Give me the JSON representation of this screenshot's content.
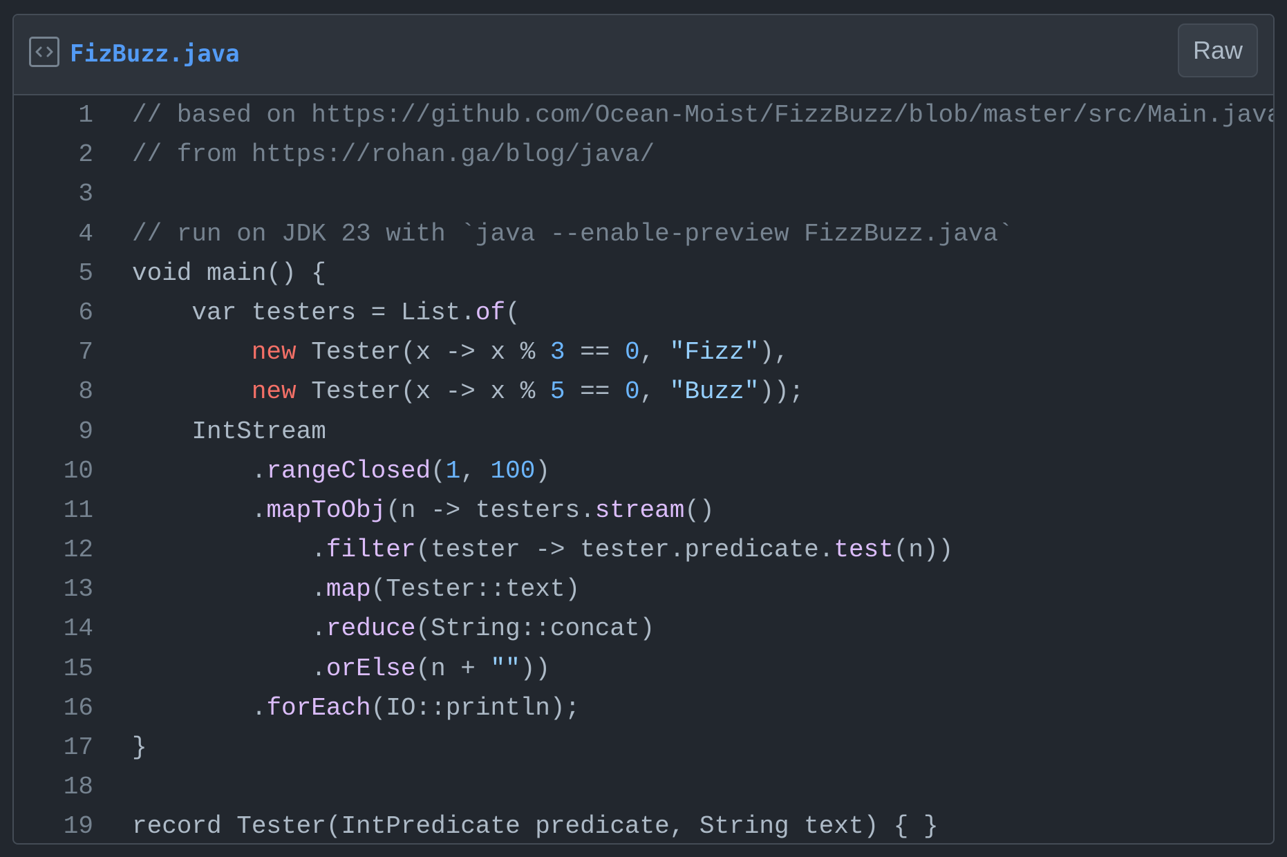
{
  "file": {
    "name": "FizBuzz.java",
    "icon": "code-file-icon",
    "raw_label": "Raw"
  },
  "colors": {
    "background": "#22272e",
    "header_background": "#2d333b",
    "border": "#444c56",
    "link": "#539bf5",
    "text": "#adbac7",
    "comment": "#768390",
    "keyword": "#f47067",
    "number": "#6cb6ff",
    "string": "#96d0ff",
    "function": "#dcbdfb"
  },
  "lines": [
    {
      "n": "1",
      "tokens": [
        {
          "t": "// based on https://github.com/Ocean-Moist/FizzBuzz/blob/master/src/Main.java",
          "c": "com"
        }
      ]
    },
    {
      "n": "2",
      "tokens": [
        {
          "t": "// from https://rohan.ga/blog/java/",
          "c": "com"
        }
      ]
    },
    {
      "n": "3",
      "tokens": []
    },
    {
      "n": "4",
      "tokens": [
        {
          "t": "// run on JDK 23 with `java --enable-preview FizzBuzz.java`",
          "c": "com"
        }
      ]
    },
    {
      "n": "5",
      "tokens": [
        {
          "t": "void main() {",
          "c": ""
        }
      ]
    },
    {
      "n": "6",
      "tokens": [
        {
          "t": "    var testers = List.",
          "c": ""
        },
        {
          "t": "of",
          "c": "fn"
        },
        {
          "t": "(",
          "c": ""
        }
      ]
    },
    {
      "n": "7",
      "tokens": [
        {
          "t": "        ",
          "c": ""
        },
        {
          "t": "new",
          "c": "kw"
        },
        {
          "t": " Tester(x -> x % ",
          "c": ""
        },
        {
          "t": "3",
          "c": "num"
        },
        {
          "t": " == ",
          "c": ""
        },
        {
          "t": "0",
          "c": "num"
        },
        {
          "t": ", ",
          "c": ""
        },
        {
          "t": "\"Fizz\"",
          "c": "str"
        },
        {
          "t": "),",
          "c": ""
        }
      ]
    },
    {
      "n": "8",
      "tokens": [
        {
          "t": "        ",
          "c": ""
        },
        {
          "t": "new",
          "c": "kw"
        },
        {
          "t": " Tester(x -> x % ",
          "c": ""
        },
        {
          "t": "5",
          "c": "num"
        },
        {
          "t": " == ",
          "c": ""
        },
        {
          "t": "0",
          "c": "num"
        },
        {
          "t": ", ",
          "c": ""
        },
        {
          "t": "\"Buzz\"",
          "c": "str"
        },
        {
          "t": "));",
          "c": ""
        }
      ]
    },
    {
      "n": "9",
      "tokens": [
        {
          "t": "    IntStream",
          "c": ""
        }
      ]
    },
    {
      "n": "10",
      "tokens": [
        {
          "t": "        .",
          "c": ""
        },
        {
          "t": "rangeClosed",
          "c": "fn"
        },
        {
          "t": "(",
          "c": ""
        },
        {
          "t": "1",
          "c": "num"
        },
        {
          "t": ", ",
          "c": ""
        },
        {
          "t": "100",
          "c": "num"
        },
        {
          "t": ")",
          "c": ""
        }
      ]
    },
    {
      "n": "11",
      "tokens": [
        {
          "t": "        .",
          "c": ""
        },
        {
          "t": "mapToObj",
          "c": "fn"
        },
        {
          "t": "(n -> testers.",
          "c": ""
        },
        {
          "t": "stream",
          "c": "fn"
        },
        {
          "t": "()",
          "c": ""
        }
      ]
    },
    {
      "n": "12",
      "tokens": [
        {
          "t": "            .",
          "c": ""
        },
        {
          "t": "filter",
          "c": "fn"
        },
        {
          "t": "(tester -> tester.predicate.",
          "c": ""
        },
        {
          "t": "test",
          "c": "fn"
        },
        {
          "t": "(n))",
          "c": ""
        }
      ]
    },
    {
      "n": "13",
      "tokens": [
        {
          "t": "            .",
          "c": ""
        },
        {
          "t": "map",
          "c": "fn"
        },
        {
          "t": "(Tester::text)",
          "c": ""
        }
      ]
    },
    {
      "n": "14",
      "tokens": [
        {
          "t": "            .",
          "c": ""
        },
        {
          "t": "reduce",
          "c": "fn"
        },
        {
          "t": "(String::concat)",
          "c": ""
        }
      ]
    },
    {
      "n": "15",
      "tokens": [
        {
          "t": "            .",
          "c": ""
        },
        {
          "t": "orElse",
          "c": "fn"
        },
        {
          "t": "(n + ",
          "c": ""
        },
        {
          "t": "\"\"",
          "c": "str"
        },
        {
          "t": "))",
          "c": ""
        }
      ]
    },
    {
      "n": "16",
      "tokens": [
        {
          "t": "        .",
          "c": ""
        },
        {
          "t": "forEach",
          "c": "fn"
        },
        {
          "t": "(IO::println);",
          "c": ""
        }
      ]
    },
    {
      "n": "17",
      "tokens": [
        {
          "t": "}",
          "c": ""
        }
      ]
    },
    {
      "n": "18",
      "tokens": []
    },
    {
      "n": "19",
      "tokens": [
        {
          "t": "record Tester(IntPredicate predicate, String text) { }",
          "c": ""
        }
      ]
    }
  ]
}
